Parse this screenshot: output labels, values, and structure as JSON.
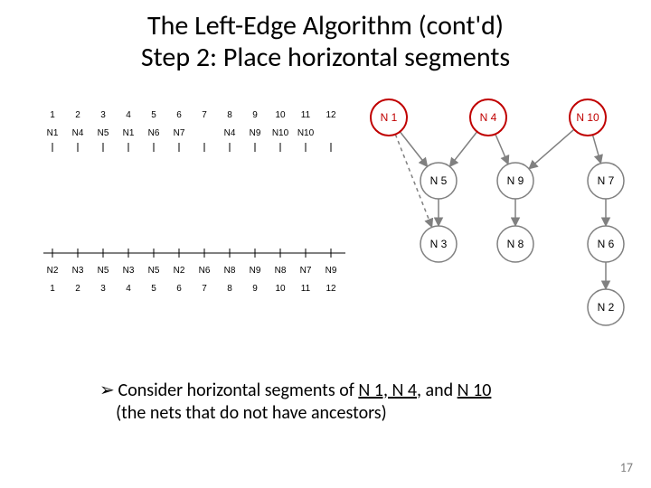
{
  "title_line1": "The Left-Edge Algorithm (cont'd)",
  "title_line2": "Step 2: Place horizontal segments",
  "bullet_arrow": "➢",
  "bullet_text_a": "Consider horizontal segments of ",
  "bullet_u1": "N 1, N 4",
  "bullet_mid": ", and ",
  "bullet_u2": "N 10",
  "bullet_text_b": "(the nets that do not have ancestors)",
  "page_num": "17",
  "columns": [
    "1",
    "2",
    "3",
    "4",
    "5",
    "6",
    "7",
    "8",
    "9",
    "10",
    "11",
    "12"
  ],
  "top_labels": [
    "N1",
    "N4",
    "N5",
    "N1",
    "N6",
    "N7",
    "",
    "N4",
    "N9",
    "N10",
    "N10",
    ""
  ],
  "bot_labels": [
    "N2",
    "N3",
    "N5",
    "N3",
    "N5",
    "N2",
    "N6",
    "N8",
    "N9",
    "N8",
    "N7",
    "N9"
  ],
  "graph": {
    "nodes": [
      {
        "id": "N1",
        "label": "N 1",
        "red": true
      },
      {
        "id": "N4",
        "label": "N 4",
        "red": true
      },
      {
        "id": "N10",
        "label": "N 10",
        "red": true
      },
      {
        "id": "N5",
        "label": "N 5",
        "red": false
      },
      {
        "id": "N9",
        "label": "N 9",
        "red": false
      },
      {
        "id": "N7",
        "label": "N 7",
        "red": false
      },
      {
        "id": "N3",
        "label": "N 3",
        "red": false
      },
      {
        "id": "N8",
        "label": "N 8",
        "red": false
      },
      {
        "id": "N6",
        "label": "N 6",
        "red": false
      },
      {
        "id": "N2",
        "label": "N 2",
        "red": false
      }
    ],
    "edges_solid": [
      [
        "N1",
        "N5"
      ],
      [
        "N4",
        "N5"
      ],
      [
        "N4",
        "N9"
      ],
      [
        "N10",
        "N9"
      ],
      [
        "N10",
        "N7"
      ],
      [
        "N5",
        "N3"
      ],
      [
        "N9",
        "N8"
      ],
      [
        "N7",
        "N6"
      ],
      [
        "N6",
        "N2"
      ]
    ],
    "edges_dashed": [
      [
        "N1",
        "N3"
      ]
    ]
  }
}
